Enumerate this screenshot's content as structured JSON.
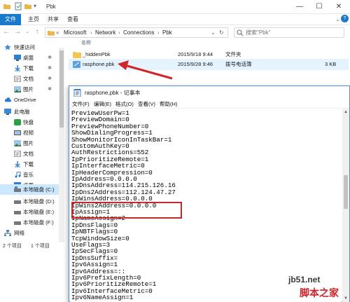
{
  "explorer": {
    "window_title": "Pbk",
    "ribbon_tabs": [
      "文件",
      "主页",
      "共享",
      "查看"
    ],
    "breadcrumb": [
      "«",
      "Microsoft",
      "Network",
      "Connections",
      "Pbk"
    ],
    "search_placeholder": "搜索\"Pbk\"",
    "columns": {
      "name": "名称"
    },
    "sidebar": {
      "items": [
        {
          "label": "快速访问",
          "icon": "star-icon",
          "pinned": false
        },
        {
          "label": "桌面",
          "icon": "desktop-icon",
          "pinned": true
        },
        {
          "label": "下载",
          "icon": "download-icon",
          "pinned": true
        },
        {
          "label": "文档",
          "icon": "documents-icon",
          "pinned": true
        },
        {
          "label": "图片",
          "icon": "pictures-icon",
          "pinned": true
        },
        {
          "label": "OneDrive",
          "icon": "cloud-icon",
          "pinned": false
        },
        {
          "label": "此电脑",
          "icon": "computer-icon",
          "pinned": false
        },
        {
          "label": "快盘",
          "icon": "drive-icon",
          "pinned": false
        },
        {
          "label": "视频",
          "icon": "video-icon",
          "pinned": false
        },
        {
          "label": "图片",
          "icon": "pictures-icon",
          "pinned": false
        },
        {
          "label": "文档",
          "icon": "documents-icon",
          "pinned": false
        },
        {
          "label": "下载",
          "icon": "download-icon",
          "pinned": false
        },
        {
          "label": "音乐",
          "icon": "music-icon",
          "pinned": false
        },
        {
          "label": "桌面",
          "icon": "desktop-icon",
          "pinned": false
        },
        {
          "label": "本地磁盘 (C:)",
          "icon": "disk-icon",
          "pinned": false
        },
        {
          "label": "本地磁盘 (D:)",
          "icon": "disk-icon",
          "pinned": false
        },
        {
          "label": "本地磁盘 (E:)",
          "icon": "disk-icon",
          "pinned": false
        },
        {
          "label": "本地磁盘 (F:)",
          "icon": "disk-icon",
          "pinned": false
        },
        {
          "label": "网络",
          "icon": "network-icon",
          "pinned": false
        }
      ]
    },
    "files": [
      {
        "name": "_hiddenPbk",
        "date": "2015/9/18 9:44",
        "type": "文件夹",
        "size": "",
        "icon": "folder-icon"
      },
      {
        "name": "rasphone.pbk",
        "date": "2015/9/28 9:46",
        "type": "拨号电话簿",
        "size": "3 KB",
        "icon": "phonebook-icon"
      }
    ],
    "status": {
      "count": "2 个项目",
      "selected": "1 个项目"
    }
  },
  "notepad": {
    "title": "rasphone.pbk - 记事本",
    "menu": [
      "文件(F)",
      "编辑(E)",
      "格式(O)",
      "查看(V)",
      "帮助(H)"
    ],
    "lines": [
      "PreviewUserPw=1",
      "PreviewDomain=0",
      "PreviewPhoneNumber=0",
      "ShowDialingProgress=1",
      "ShowMonitorIconInTaskBar=1",
      "CustomAuthKey=0",
      "AuthRestrictions=552",
      "IpPrioritizeRemote=1",
      "IpInterfaceMetric=0",
      "IpHeaderCompression=0",
      "IpAddress=0.0.0.0",
      "IpDnsAddress=114.215.126.16",
      "IpDns2Address=112.124.47.27",
      "IpWinsAddress=0.0.0.0",
      "IpWins2Address=0.0.0.0",
      "IpAssign=1",
      "IpNameAssign=2",
      "IpDnsFlags=0",
      "IpNBTFlags=0",
      "TcpWindowSize=0",
      "UseFlags=3",
      "IpSecFlags=0",
      "IpDnsSuffix=",
      "Ipv6Assign=1",
      "Ipv6Address=::",
      "Ipv6PrefixLength=0",
      "Ipv6PrioritizeRemote=1",
      "Ipv6InterfaceMetric=0",
      "Ipv6NameAssign=1"
    ]
  },
  "watermark": {
    "site": "jb51.net",
    "name": "脚本之家"
  },
  "colors": {
    "accent": "#1979ca",
    "highlight_red": "#c8262b",
    "selection": "#cce8ff"
  }
}
